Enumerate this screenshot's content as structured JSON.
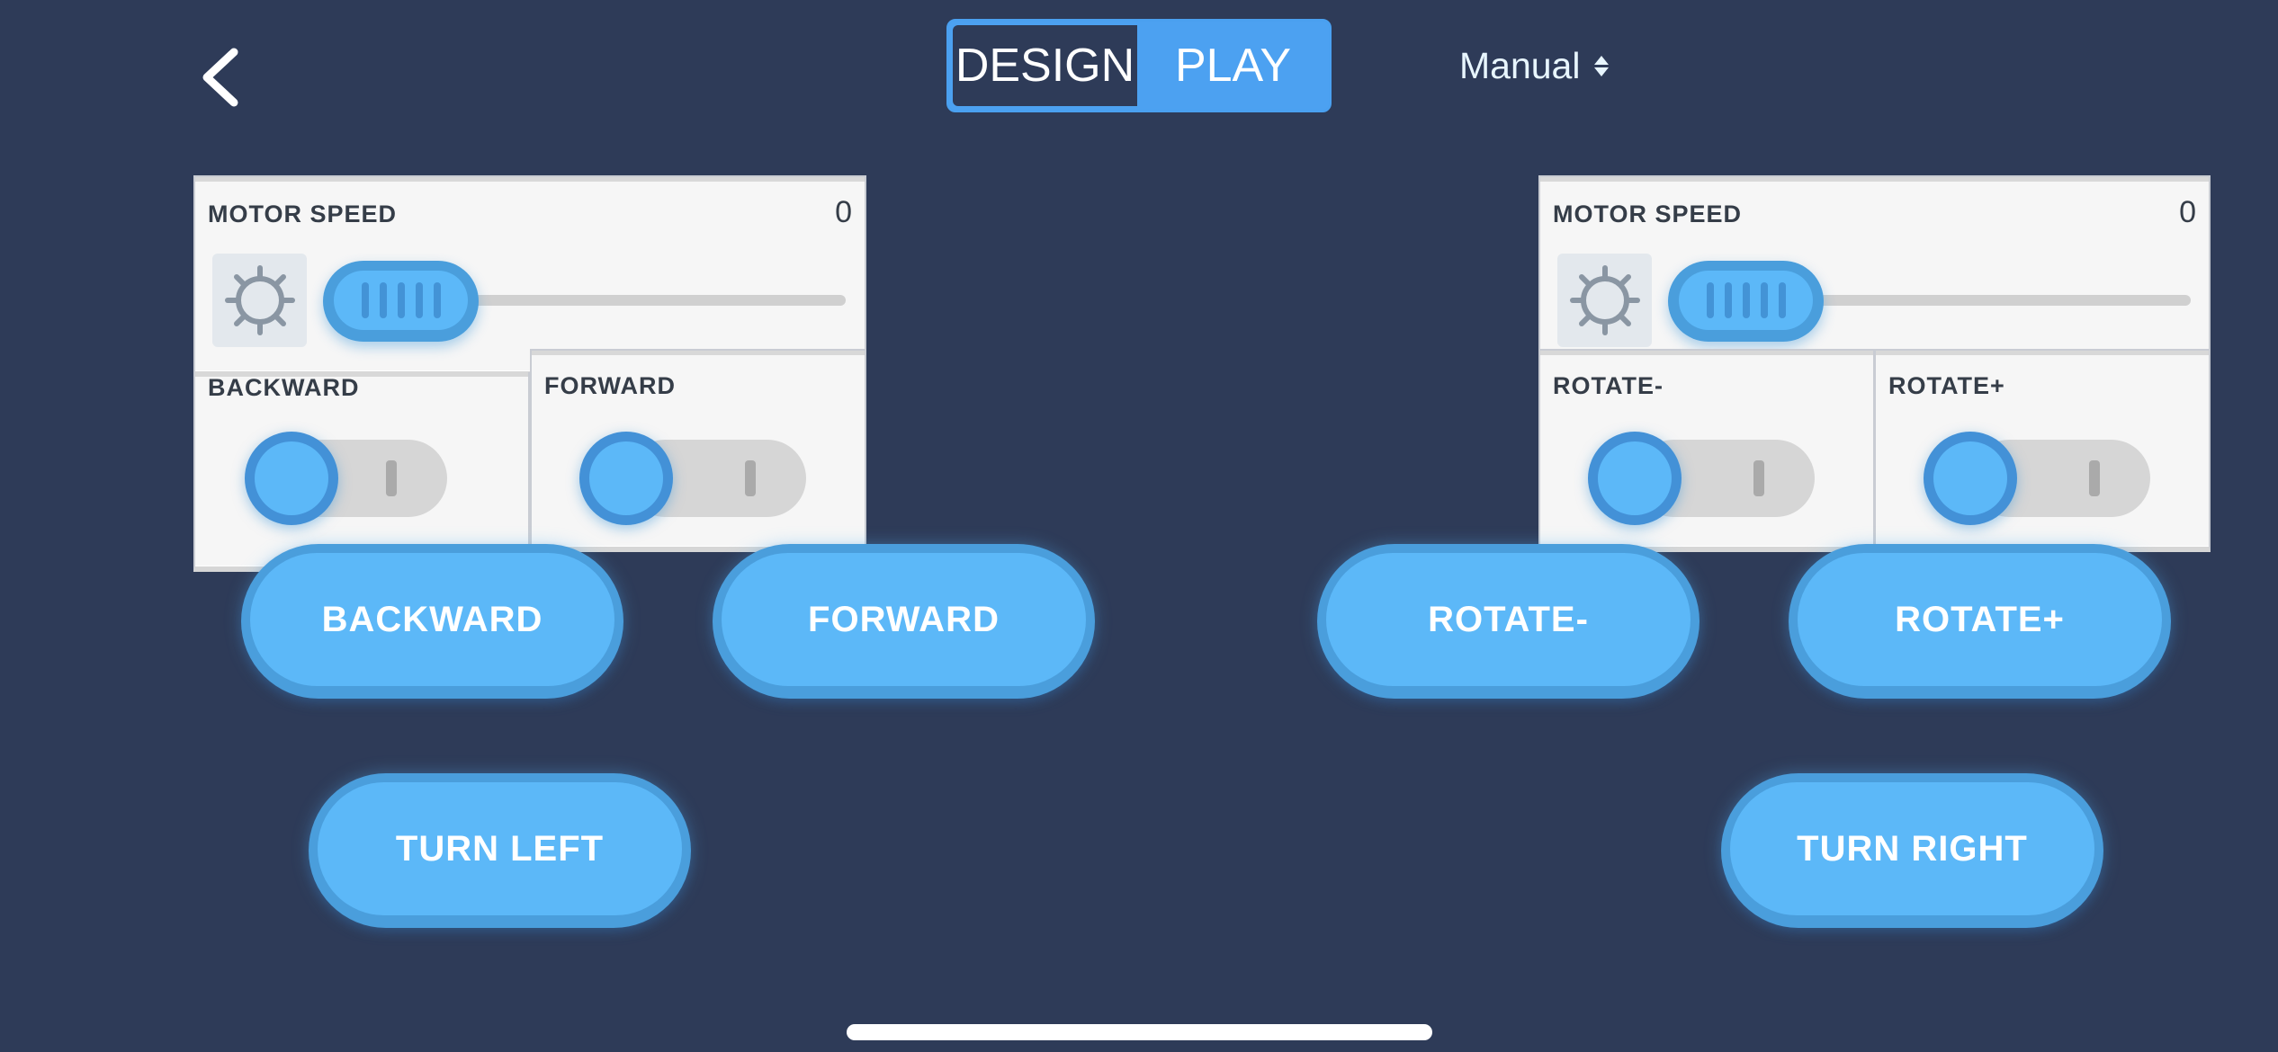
{
  "header": {
    "back_icon": "chevron-left-icon",
    "mode_toggle": {
      "options": [
        "DESIGN",
        "PLAY"
      ],
      "selected": "PLAY"
    },
    "mode_select": {
      "value": "Manual",
      "icon": "up-down-arrows-icon"
    }
  },
  "colors": {
    "background": "#2e3b58",
    "accent": "#5cb8f8",
    "accent_dark": "#4a9edc",
    "panel": "#f6f6f6",
    "toggle_active": "#4ca1f1"
  },
  "left_group": {
    "motor_speed": {
      "label": "MOTOR SPEED",
      "value": "0",
      "slider_fraction": 0,
      "icon": "gear-icon"
    },
    "switches": [
      {
        "label": "BACKWARD",
        "on": false
      },
      {
        "label": "FORWARD",
        "on": false
      }
    ],
    "buttons": [
      "BACKWARD",
      "FORWARD",
      "TURN LEFT"
    ]
  },
  "right_group": {
    "motor_speed": {
      "label": "MOTOR SPEED",
      "value": "0",
      "slider_fraction": 0,
      "icon": "gear-icon"
    },
    "switches": [
      {
        "label": "ROTATE-",
        "on": false
      },
      {
        "label": "ROTATE+",
        "on": false
      }
    ],
    "buttons": [
      "ROTATE-",
      "ROTATE+",
      "TURN RIGHT"
    ]
  }
}
